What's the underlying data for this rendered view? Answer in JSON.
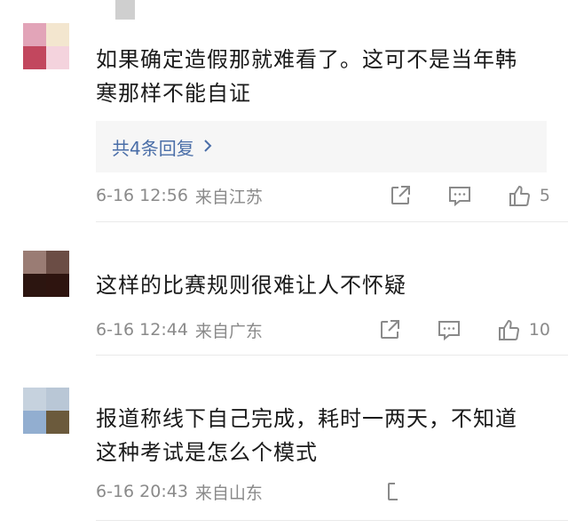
{
  "comments": [
    {
      "text": "如果确定造假那就难看了。这可不是当年韩寒那样不能自证",
      "text_line1": "如果确定造假那就难看了。这可不是当年韩",
      "text_line2": "寒那样不能自证",
      "replies_label": "共4条回复",
      "date": "6-16 12:56",
      "location": "来自江苏",
      "likes": "5",
      "avatar_colors": [
        "#e2a4b8",
        "#f3e6cf",
        "#c2475e",
        "#f4d3dd"
      ]
    },
    {
      "text": "这样的比赛规则很难让人不怀疑",
      "date": "6-16 12:44",
      "location": "来自广东",
      "likes": "10",
      "avatar_colors": [
        "#9a7c74",
        "#6b4d45",
        "#2c1510",
        "#2e140f"
      ]
    },
    {
      "text_line1": "报道称线下自己完成，耗时一两天，不知道",
      "text_line2": "这种考试是怎么个模式",
      "date": "6-16 20:43",
      "location": "来自山东",
      "avatar_colors": [
        "#c6d2de",
        "#b9c7d6",
        "#92aed0",
        "#6b5a3c"
      ]
    }
  ],
  "icons": {
    "share": "share-icon",
    "reply": "comment-icon",
    "like": "thumbs-up-icon",
    "chevron": "chevron-right-icon"
  },
  "colors": {
    "link_blue": "#4a6ea8",
    "meta_gray": "#8a8a8a",
    "reply_bg": "#f6f6f6"
  }
}
